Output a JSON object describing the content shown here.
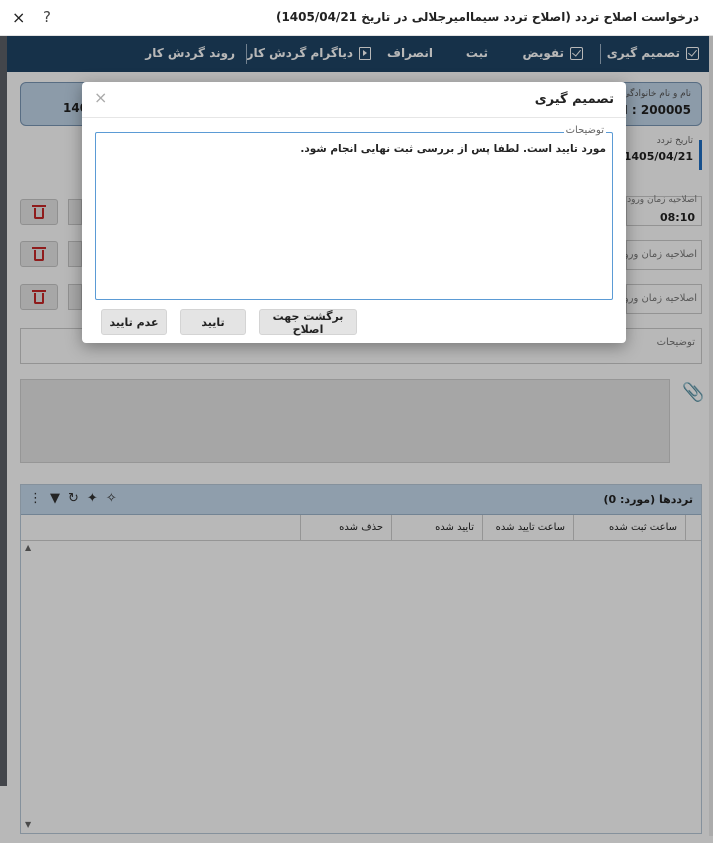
{
  "window": {
    "title": "درخواست اصلاح تردد (اصلاح تردد سیماامیرجلالی در تاریخ 1405/04/21)",
    "close_glyph": "×",
    "help_glyph": "?"
  },
  "toolbar": {
    "items": [
      {
        "label": "تصمیم گیری",
        "icon": "checkbox-icon"
      },
      {
        "label": "تفویض",
        "icon": "checkbox-icon"
      },
      {
        "label": "ثبت",
        "icon": ""
      },
      {
        "label": "انصراف",
        "icon": ""
      },
      {
        "label": "دیاگرام گردش کار",
        "icon": "play-document-icon"
      },
      {
        "label": "روند گردش کار",
        "icon": ""
      }
    ]
  },
  "info_panel": {
    "label": "نام و نام خانوادگی",
    "value": "200005 : احم",
    "left_value": "140"
  },
  "date_field": {
    "label": "تاریخ تردد",
    "value": "1405/04/21"
  },
  "time_rows": [
    {
      "label": "اصلاحیه زمان ورود",
      "value": "08:10"
    },
    {
      "label": "اصلاحیه زمان ورود",
      "value": ""
    },
    {
      "label": "اصلاحیه زمان ورود",
      "value": ""
    }
  ],
  "description_field": {
    "label": "توضیحات"
  },
  "grid": {
    "title": "ترددها (مورد: 0)",
    "columns": [
      "",
      "ساعت ثبت شده",
      "ساعت تایید شده",
      "تایید شده",
      "حذف شده"
    ],
    "icons": [
      "more-vertical-icon",
      "filter-icon",
      "refresh-icon",
      "tag-add-icon",
      "tag-remove-icon"
    ]
  },
  "modal": {
    "title": "تصمیم گیری",
    "close_glyph": "×",
    "field_label": "توضیحات",
    "field_value": "مورد تایید است. لطفا پس از بررسی ثبت نهایی انجام شود.",
    "buttons": {
      "return": "برگشت جهت اصلاح",
      "approve": "تایید",
      "reject": "عدم تایید"
    }
  },
  "colors": {
    "toolbar_bg": "#1f4566",
    "info_panel_bg": "#c3d7ea",
    "delete_icon": "#c62828",
    "focus_border": "#5b9bd5"
  }
}
